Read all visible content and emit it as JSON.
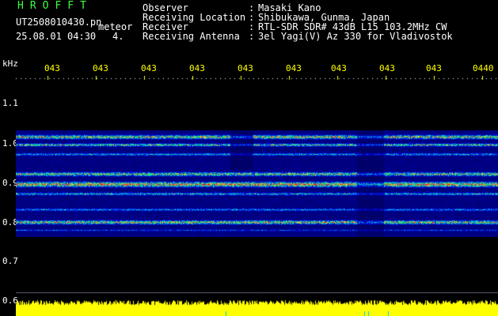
{
  "header": {
    "logo": "HROFFT",
    "file_name": "UT2508010430.pn",
    "file_suffix": "meteor",
    "date_time": "25.08.01 04:30",
    "minute_tag": "4.",
    "info": [
      {
        "label": "Observer",
        "value": "Masaki Kano"
      },
      {
        "label": "Receiving Location",
        "value": "Shibukawa, Gunma, Japan"
      },
      {
        "label": "Receiver",
        "value": "RTL-SDR SDR# 43dB L15 103.2MHz CW"
      },
      {
        "label": "Receiving Antenna",
        "value": "3el Yagi(V) Az 330 for Vladivostok"
      }
    ],
    "separator": ":"
  },
  "axes": {
    "y_unit": "kHz",
    "y_ticks": [
      "1.1",
      "1.0",
      "0.9",
      "0.8",
      "0.7",
      "0.6"
    ],
    "x_ticks": [
      "043",
      "043",
      "043",
      "043",
      "043",
      "043",
      "043",
      "043",
      "043",
      "0440"
    ]
  },
  "colors": {
    "logo": "#3cff3c",
    "tick_top": "#ffff00",
    "baseline": "#ffff00",
    "background": "#000000"
  }
}
